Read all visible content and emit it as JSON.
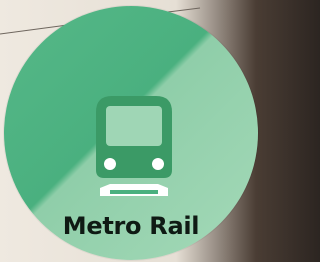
{
  "badge": {
    "label": "Metro Rail",
    "icon": "metro-train-icon",
    "colors": {
      "primary_green": "#4ab07f",
      "light_green": "#a4d9b8",
      "train": "#3b9a66",
      "train_window": "#9fd6b5",
      "rail": "#ffffff",
      "text": "#0f1a14"
    }
  }
}
